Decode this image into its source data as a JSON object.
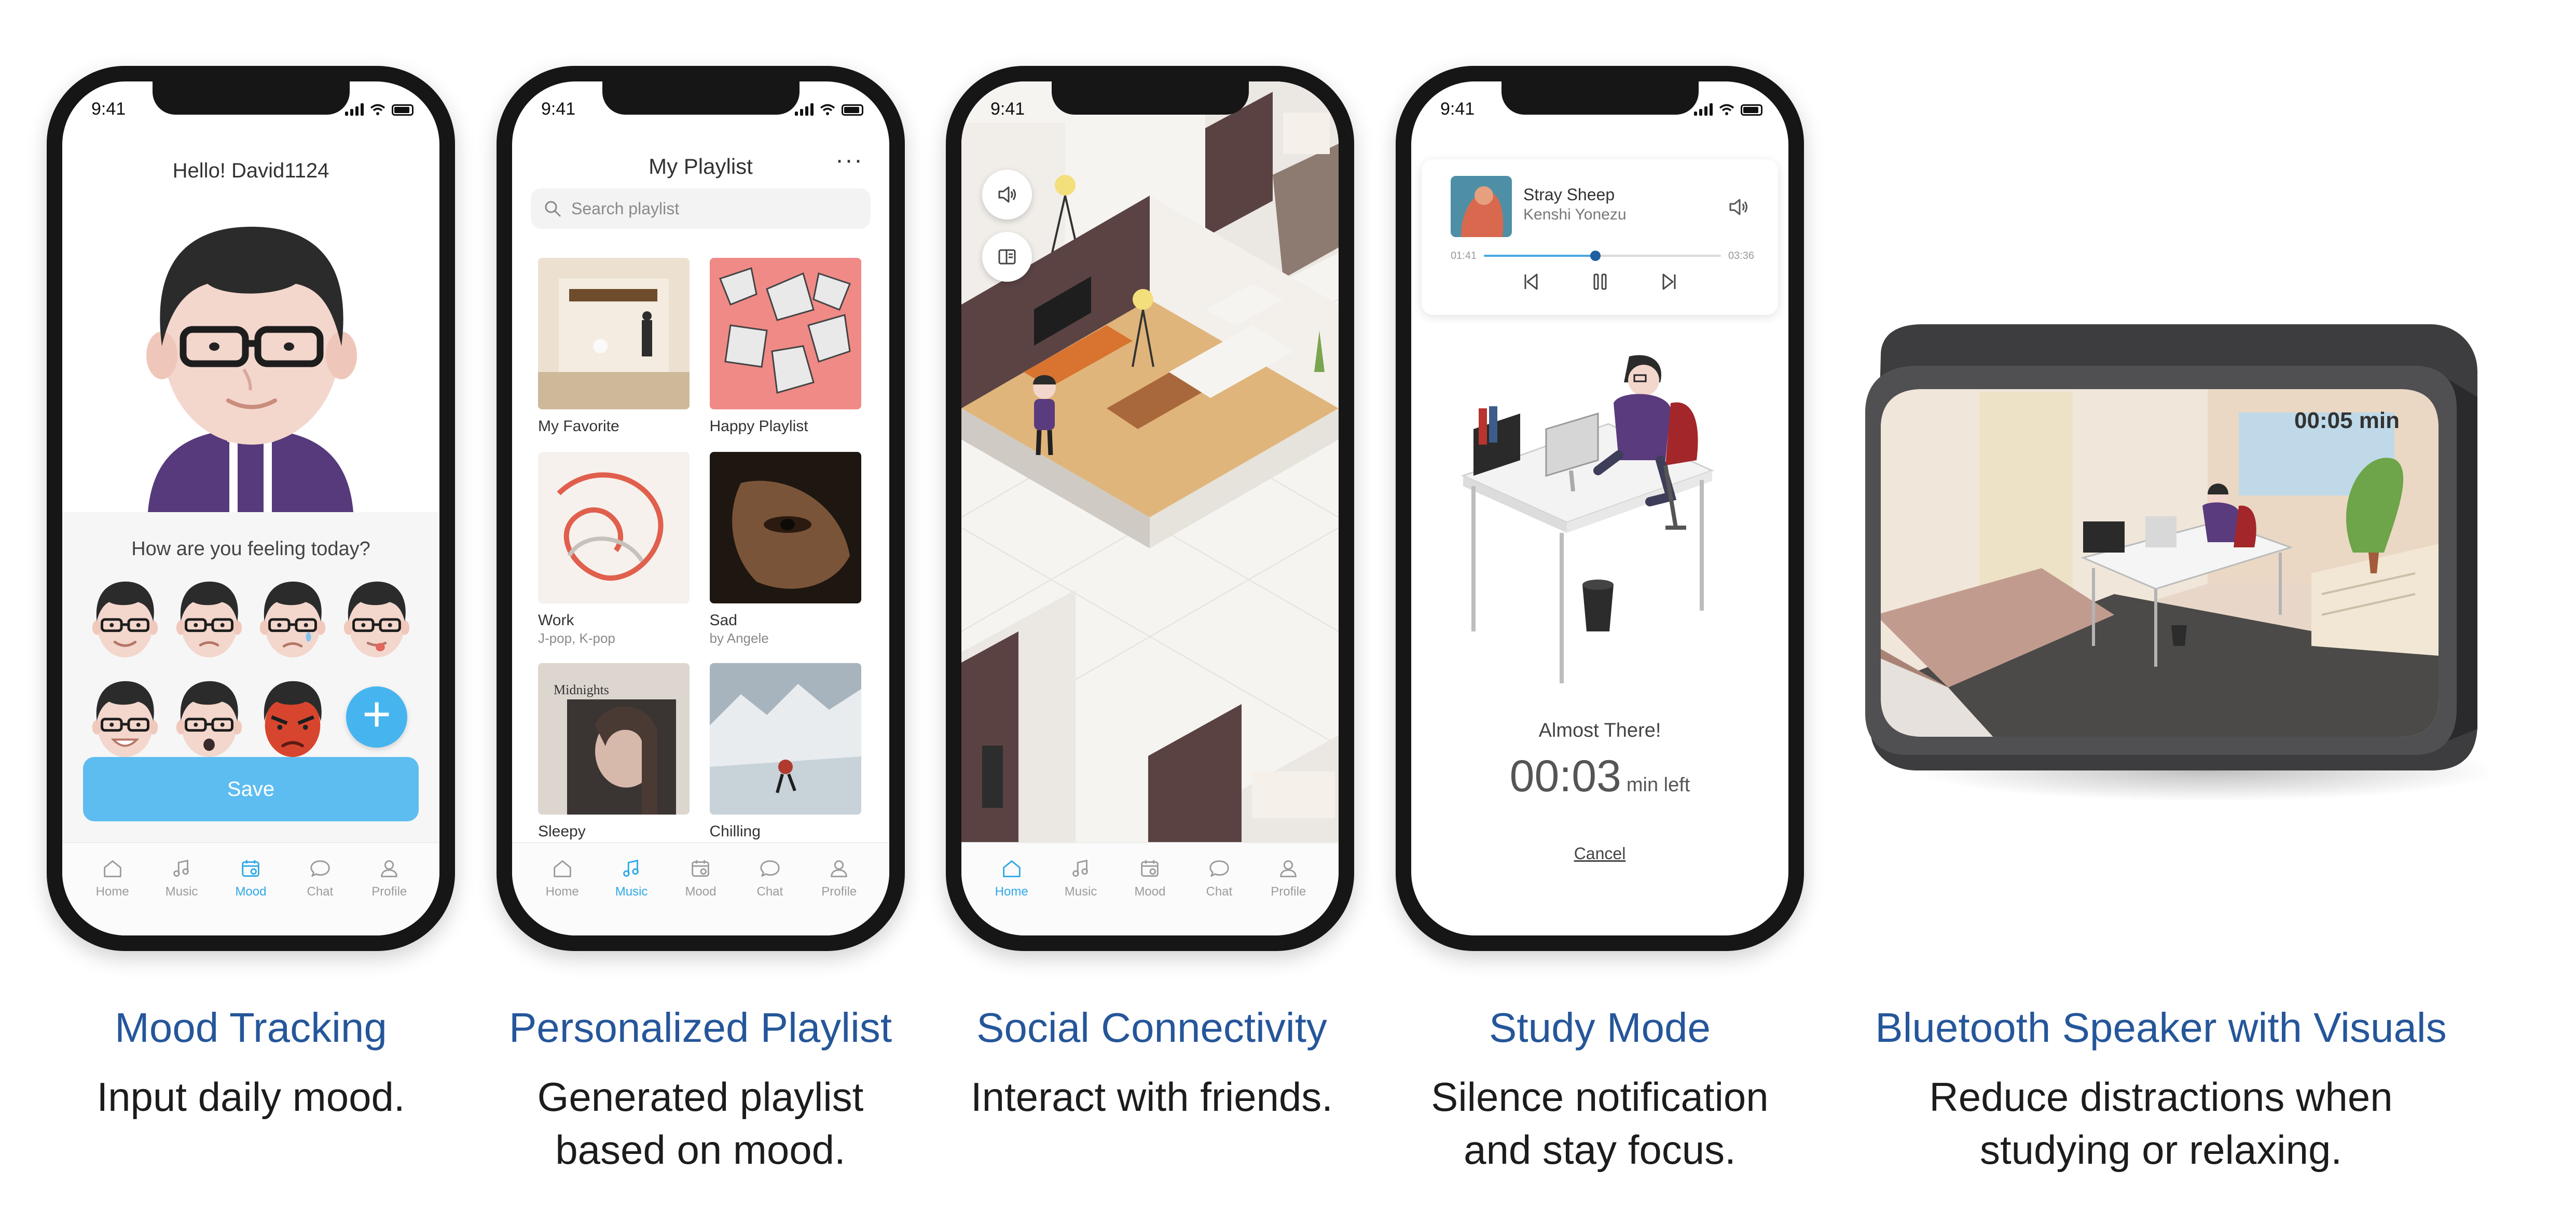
{
  "status_time": "9:41",
  "nav": [
    {
      "label": "Home",
      "icon": "home-icon"
    },
    {
      "label": "Music",
      "icon": "music-icon"
    },
    {
      "label": "Mood",
      "icon": "mood-calendar-icon"
    },
    {
      "label": "Chat",
      "icon": "chat-icon"
    },
    {
      "label": "Profile",
      "icon": "profile-icon"
    }
  ],
  "mood_screen": {
    "greeting": "Hello! David1124",
    "question": "How are you feeling today?",
    "moods": [
      "happy-face-icon",
      "neutral-face-icon",
      "sad-face-icon",
      "silly-face-icon",
      "smile-face-icon",
      "surprised-face-icon",
      "angry-face-icon"
    ],
    "add_label": "+",
    "save_label": "Save",
    "active_tab": "Mood"
  },
  "playlist_screen": {
    "title": "My Playlist",
    "more_label": "···",
    "search_placeholder": "Search playlist",
    "albums": [
      {
        "title": "My Favorite",
        "subtitle": ""
      },
      {
        "title": "Happy Playlist",
        "subtitle": ""
      },
      {
        "title": "Work",
        "subtitle": "J-pop, K-pop"
      },
      {
        "title": "Sad",
        "subtitle": "by Angele"
      },
      {
        "title": "Sleepy",
        "subtitle": ""
      },
      {
        "title": "Chilling",
        "subtitle": ""
      }
    ],
    "cover_text_midnights": "Midnights",
    "active_tab": "Music"
  },
  "social_screen": {
    "active_tab": "Home"
  },
  "study_screen": {
    "song": "Stray Sheep",
    "artist": "Kenshi Yonezu",
    "elapsed": "01:41",
    "total": "03:36",
    "progress": 0.47,
    "message": "Almost There!",
    "remaining": "00:03",
    "remaining_unit": "min left",
    "cancel_label": "Cancel"
  },
  "speaker_display": {
    "timer": "00:05 min"
  },
  "captions": [
    {
      "heading": "Mood Tracking",
      "line1": "Input daily mood.",
      "line2": ""
    },
    {
      "heading": "Personalized Playlist",
      "line1": "Generated playlist",
      "line2": "based on mood."
    },
    {
      "heading": "Social Connectivity",
      "line1": "Interact with friends.",
      "line2": ""
    },
    {
      "heading": "Study Mode",
      "line1": "Silence notification",
      "line2": "and stay focus."
    },
    {
      "heading": "Bluetooth Speaker with Visuals",
      "line1": "Reduce distractions when",
      "line2": "studying or relaxing."
    }
  ],
  "colors": {
    "accent": "#2fa8e8",
    "save_button": "#5ebdf0",
    "caption_heading": "#25569a",
    "phone_frame": "#161616"
  }
}
